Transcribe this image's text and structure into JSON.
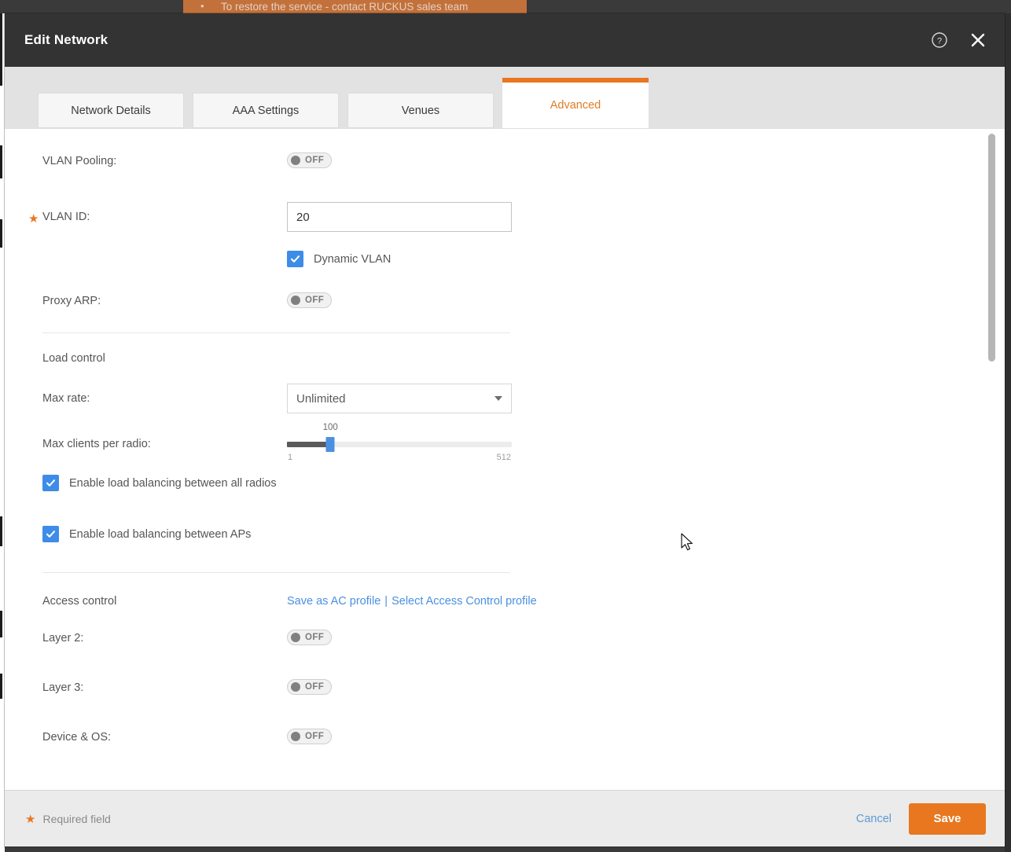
{
  "background": {
    "banner_bullet": "•",
    "banner_text": "To restore the service - contact RUCKUS sales team"
  },
  "modal": {
    "title": "Edit Network",
    "header_icons": {
      "help": "help-circle-icon",
      "close": "close-icon"
    },
    "tabs": [
      {
        "label": "Network Details",
        "active": false
      },
      {
        "label": "AAA Settings",
        "active": false
      },
      {
        "label": "Venues",
        "active": false
      },
      {
        "label": "Advanced",
        "active": true
      }
    ],
    "form": {
      "vlan_pooling": {
        "label": "VLAN Pooling:",
        "toggle_state": "OFF"
      },
      "vlan_id": {
        "label": "VLAN ID:",
        "required": true,
        "value": "20",
        "required_marker": "★"
      },
      "dynamic_vlan": {
        "label": "Dynamic VLAN",
        "checked": true
      },
      "proxy_arp": {
        "label": "Proxy ARP:",
        "toggle_state": "OFF"
      },
      "load_control": {
        "section_title": "Load control",
        "max_rate": {
          "label": "Max rate:",
          "value": "Unlimited"
        },
        "max_clients": {
          "label": "Max clients per radio:",
          "value": "100",
          "min": "1",
          "max": "512",
          "percent": 19.3
        },
        "load_balance_radios": {
          "label": "Enable load balancing between all radios",
          "checked": true
        },
        "load_balance_aps": {
          "label": "Enable load balancing between APs",
          "checked": true
        }
      },
      "access_control": {
        "section_title": "Access control",
        "save_profile_link": "Save as AC profile",
        "link_separator": "|",
        "select_profile_link": "Select Access Control profile",
        "layer2": {
          "label": "Layer 2:",
          "toggle_state": "OFF"
        },
        "layer3": {
          "label": "Layer 3:",
          "toggle_state": "OFF"
        },
        "device_os": {
          "label": "Device & OS:",
          "toggle_state": "OFF"
        }
      }
    },
    "footer": {
      "required_star": "★",
      "required_text": "Required field",
      "cancel_label": "Cancel",
      "save_label": "Save"
    }
  },
  "colors": {
    "accent_orange": "#e8771f",
    "link_blue": "#4a90e2",
    "checkbox_blue": "#3d8ce8",
    "header_dark": "#333333",
    "tabbar_gray": "#e2e2e2"
  }
}
